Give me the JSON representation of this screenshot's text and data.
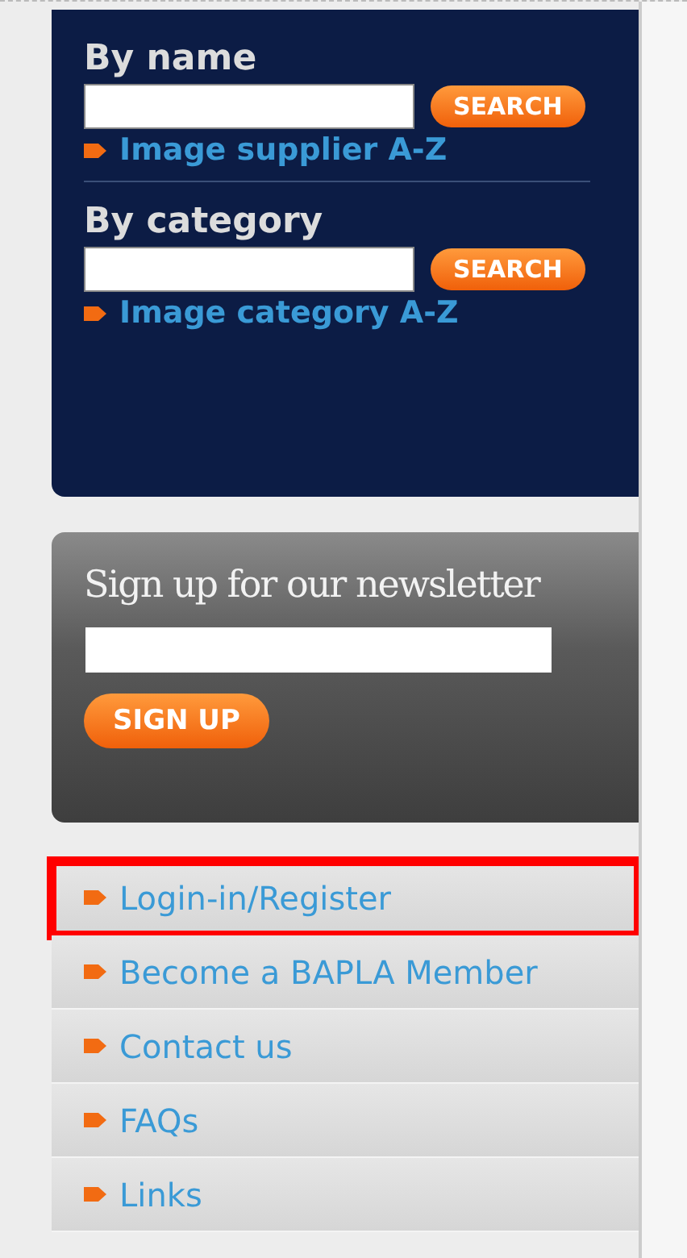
{
  "search_sections": [
    {
      "heading": "By name",
      "button": "SEARCH",
      "link": "Image supplier A-Z"
    },
    {
      "heading": "By category",
      "button": "SEARCH",
      "link": "Image category A-Z"
    }
  ],
  "newsletter": {
    "heading": "Sign up for our newsletter",
    "button": "SIGN UP"
  },
  "menu": [
    {
      "label": "Login-in/Register",
      "highlighted": true
    },
    {
      "label": "Become a BAPLA Member",
      "highlighted": false
    },
    {
      "label": "Contact us",
      "highlighted": false
    },
    {
      "label": "FAQs",
      "highlighted": false
    },
    {
      "label": "Links",
      "highlighted": false
    }
  ]
}
